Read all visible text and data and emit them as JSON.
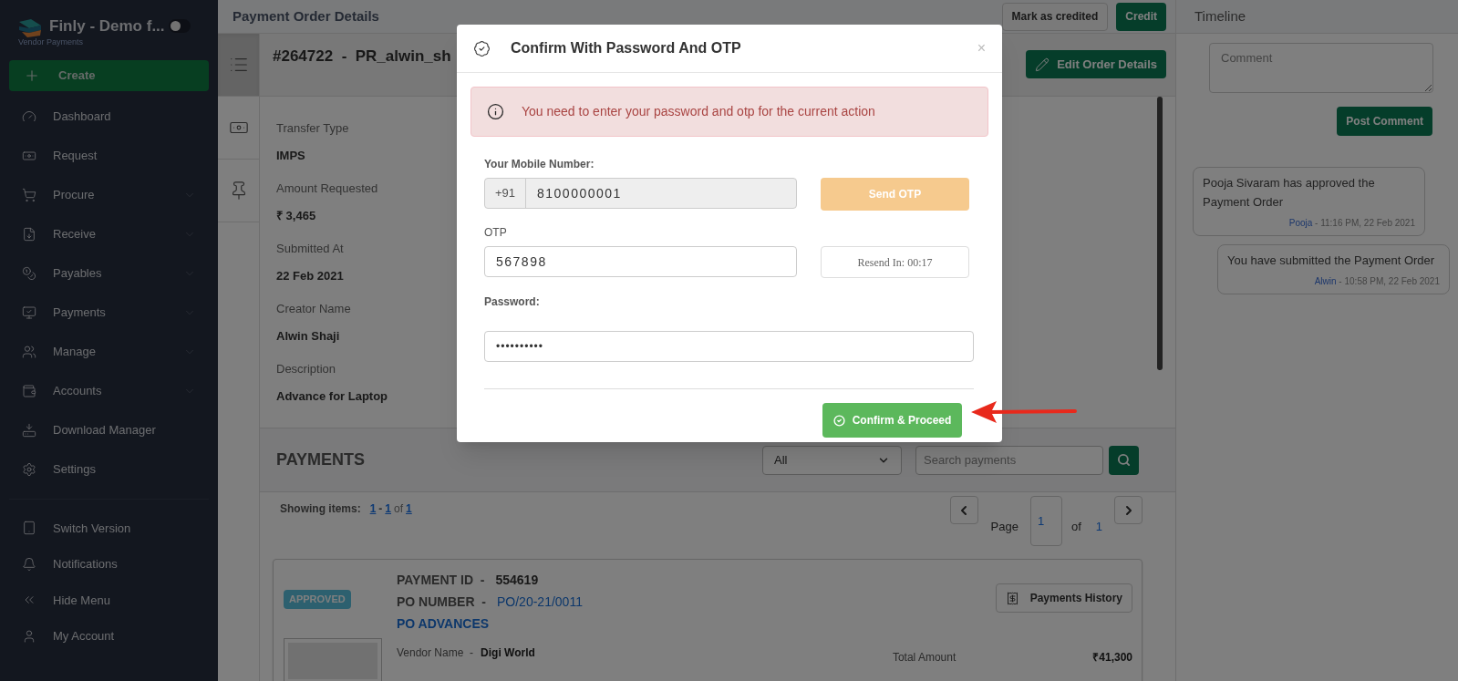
{
  "sidebar": {
    "brand": "Finly - Demo f...",
    "subtitle": "Vendor Payments",
    "toggle": {
      "on": false
    },
    "create": "Create",
    "items": [
      {
        "label": "Dashboard",
        "has_submenu": false
      },
      {
        "label": "Request",
        "has_submenu": false
      },
      {
        "label": "Procure",
        "has_submenu": true
      },
      {
        "label": "Receive",
        "has_submenu": true
      },
      {
        "label": "Payables",
        "has_submenu": true
      },
      {
        "label": "Payments",
        "has_submenu": true
      },
      {
        "label": "Manage",
        "has_submenu": true
      },
      {
        "label": "Accounts",
        "has_submenu": true
      },
      {
        "label": "Download Manager",
        "has_submenu": false
      },
      {
        "label": "Settings",
        "has_submenu": false
      }
    ],
    "footer_items": [
      "Switch Version",
      "Notifications",
      "Hide Menu",
      "My Account"
    ]
  },
  "header": {
    "title": "Payment Order Details",
    "buttons": [
      "Mark as credited",
      "Credit"
    ],
    "timeline_title": "Timeline"
  },
  "side_tabs": [
    {
      "selected": true
    },
    {
      "selected": false
    },
    {
      "selected": false
    }
  ],
  "order": {
    "title": "#264722  -  PR_alwin_sh",
    "edit_button": "Edit Order Details",
    "fields": [
      {
        "label": "Transfer Type",
        "value": "IMPS"
      },
      {
        "label": "Amount Requested",
        "value": "₹ 3,465"
      },
      {
        "label": "Submitted At",
        "value": "22 Feb 2021"
      },
      {
        "label": "Creator Name",
        "value": "Alwin Shaji"
      },
      {
        "label": "Description",
        "value": "Advance for Laptop"
      }
    ]
  },
  "payments": {
    "title": "PAYMENTS",
    "filter": "All",
    "search_placeholder": "Search payments",
    "showing_label": "Showing items:",
    "range_start": "1",
    "range_sep": "-",
    "range_end": "1",
    "of": "of",
    "total": "1",
    "page_label": "Page",
    "page": "1",
    "page_of": "of",
    "page_total": "1",
    "card": {
      "status": "APPROVED",
      "payment_id_label": "PAYMENT ID  -",
      "payment_id": "554619",
      "po_label": "PO NUMBER  -",
      "po_number": "PO/20-21/0011",
      "po_type": "PO ADVANCES",
      "vendor_label": "Vendor Name  -",
      "vendor": "Digi World",
      "total_label": "Total Amount",
      "total": "₹41,300",
      "history_button": "Payments History"
    }
  },
  "timeline": {
    "comment_placeholder": "Comment",
    "post_button": "Post Comment",
    "entries": [
      {
        "text": "Pooja Sivaram has approved the Payment Order",
        "author": "Pooja",
        "time": " - 11:16 PM, 22 Feb 2021"
      },
      {
        "text": "You have submitted the Payment Order",
        "author": "Alwin",
        "time": " - 10:58 PM, 22 Feb 2021"
      }
    ]
  },
  "modal": {
    "title": "Confirm With Password And OTP",
    "close": "×",
    "alert": "You need to enter your password and otp for the current action",
    "mobile_label": "Your Mobile Number:",
    "country_code": "+91",
    "mobile": "8100000001",
    "send_otp": "Send OTP",
    "send_disabled": true,
    "otp_label": "OTP",
    "otp": "567898",
    "resend": "Resend In: 00:17",
    "password_label": "Password:",
    "password": "••••••••••",
    "confirm": "Confirm & Proceed"
  }
}
